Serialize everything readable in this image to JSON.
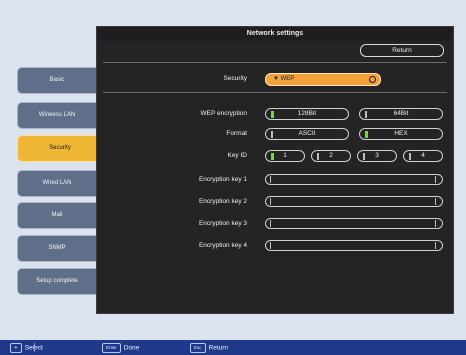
{
  "panel": {
    "title": "Network settings",
    "return_label": "Return"
  },
  "sidebar": {
    "tabs": [
      {
        "label": "Basic"
      },
      {
        "label": "Wireless LAN"
      },
      {
        "label": "Security",
        "active": true
      },
      {
        "label": "Wired LAN"
      },
      {
        "label": "Mail"
      },
      {
        "label": "SNMP"
      },
      {
        "label": "Setup complete"
      }
    ]
  },
  "security": {
    "label": "Security",
    "value": "WEP"
  },
  "wep_encryption": {
    "label": "WEP encryption",
    "options": [
      "128Bit",
      "64Bit"
    ],
    "selected": "128Bit"
  },
  "format": {
    "label": "Format",
    "options": [
      "ASCII",
      "HEX"
    ],
    "selected": "HEX"
  },
  "key_id": {
    "label": "Key ID",
    "options": [
      "1",
      "2",
      "3",
      "4"
    ],
    "selected": "1"
  },
  "encryption_keys": [
    {
      "label": "Encryption key 1",
      "value": ""
    },
    {
      "label": "Encryption key 2",
      "value": ""
    },
    {
      "label": "Encryption key 3",
      "value": ""
    },
    {
      "label": "Encryption key 4",
      "value": ""
    }
  ],
  "bottom_bar": {
    "select_label": "Select",
    "enter_key": "Enter",
    "done_label": "Done",
    "esc_key": "Esc",
    "return_label": "Return"
  },
  "colors": {
    "accent": "#f0b636",
    "selected_indicator": "#7fd14a",
    "bottom_bar": "#1f3a8a",
    "panel": "#252425"
  }
}
